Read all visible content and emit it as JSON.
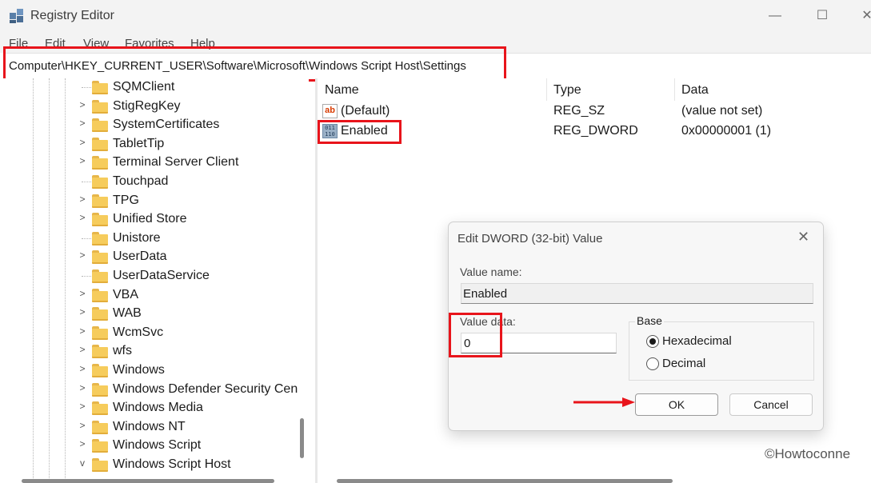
{
  "window": {
    "title": "Registry Editor",
    "controls": {
      "minimize": "—",
      "maximize": "☐",
      "close": "✕"
    }
  },
  "menu": [
    "File",
    "Edit",
    "View",
    "Favorites",
    "Help"
  ],
  "address": "Computer\\HKEY_CURRENT_USER\\Software\\Microsoft\\Windows Script Host\\Settings",
  "tree": {
    "items": [
      {
        "label": "SQMClient",
        "expander": "none"
      },
      {
        "label": "StigRegKey",
        "expander": ">"
      },
      {
        "label": "SystemCertificates",
        "expander": ">"
      },
      {
        "label": "TabletTip",
        "expander": ">"
      },
      {
        "label": "Terminal Server Client",
        "expander": ">"
      },
      {
        "label": "Touchpad",
        "expander": "none"
      },
      {
        "label": "TPG",
        "expander": ">"
      },
      {
        "label": "Unified Store",
        "expander": ">"
      },
      {
        "label": "Unistore",
        "expander": "none"
      },
      {
        "label": "UserData",
        "expander": ">"
      },
      {
        "label": "UserDataService",
        "expander": "none"
      },
      {
        "label": "VBA",
        "expander": ">"
      },
      {
        "label": "WAB",
        "expander": ">"
      },
      {
        "label": "WcmSvc",
        "expander": ">"
      },
      {
        "label": "wfs",
        "expander": ">"
      },
      {
        "label": "Windows",
        "expander": ">"
      },
      {
        "label": "Windows Defender Security Cen",
        "expander": ">"
      },
      {
        "label": "Windows Media",
        "expander": ">"
      },
      {
        "label": "Windows NT",
        "expander": ">"
      },
      {
        "label": "Windows Script",
        "expander": ">"
      },
      {
        "label": "Windows Script Host",
        "expander": "v"
      }
    ]
  },
  "list": {
    "columns": {
      "name": "Name",
      "type": "Type",
      "data": "Data"
    },
    "rows": [
      {
        "name": "(Default)",
        "type": "REG_SZ",
        "data": "(value not set)",
        "icon": "string-value-icon",
        "glyph": "ab"
      },
      {
        "name": "Enabled",
        "type": "REG_DWORD",
        "data": "0x00000001 (1)",
        "icon": "binary-value-icon",
        "glyph": "011\n110"
      }
    ]
  },
  "dialog": {
    "title": "Edit DWORD (32-bit) Value",
    "close": "✕",
    "value_name_label": "Value name:",
    "value_name": "Enabled",
    "value_data_label": "Value data:",
    "value_data": "0",
    "base_label": "Base",
    "hex_label": "Hexadecimal",
    "dec_label": "Decimal",
    "selected_base": "Hexadecimal",
    "ok_label": "OK",
    "cancel_label": "Cancel"
  },
  "watermark": "©Howtoconne",
  "colors": {
    "highlight": "#e8141b",
    "folder": "#f6cc5c"
  }
}
